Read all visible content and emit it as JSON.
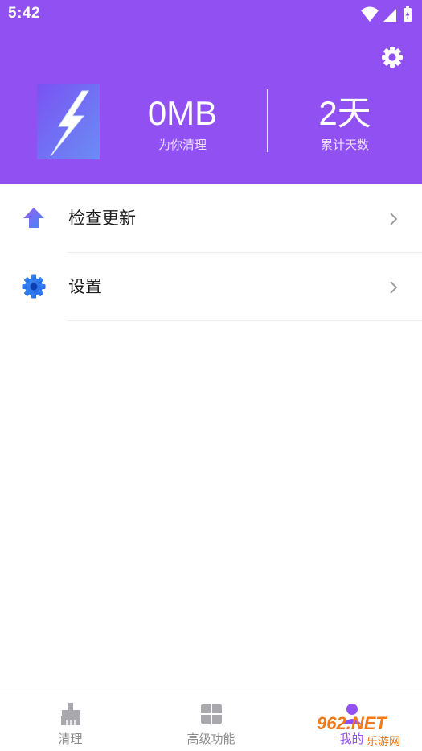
{
  "status_bar": {
    "time": "5:42"
  },
  "header": {
    "background_color": "#9151f2",
    "settings_icon": "gear-icon",
    "logo_icon": "lightning-bolt-icon",
    "stats": [
      {
        "value": "0MB",
        "label": "为你清理"
      },
      {
        "value": "2天",
        "label": "累计天数"
      }
    ]
  },
  "menu": {
    "items": [
      {
        "icon": "upload-arrow-icon",
        "label": "检查更新"
      },
      {
        "icon": "gear-icon",
        "label": "设置"
      }
    ]
  },
  "bottom_nav": {
    "items": [
      {
        "icon": "broom-icon",
        "label": "清理"
      },
      {
        "icon": "four-petal-icon",
        "label": "高级功能"
      },
      {
        "icon": "user-icon",
        "label": "我的",
        "active": true
      }
    ]
  },
  "watermark": {
    "text_main": "962.NET",
    "text_sub": "乐游网"
  }
}
